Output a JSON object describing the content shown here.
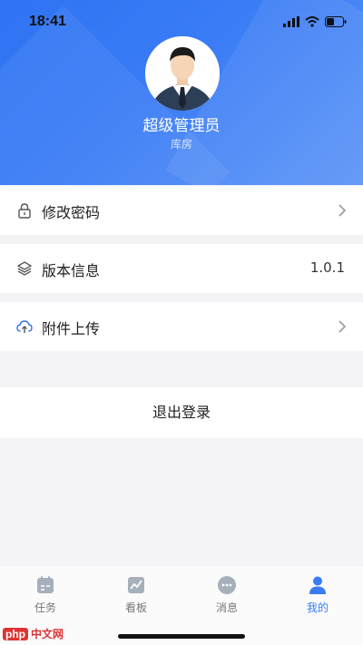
{
  "status_bar": {
    "time": "18:41"
  },
  "profile": {
    "name": "超级管理员",
    "role": "库房"
  },
  "menu": [
    {
      "label": "修改密码",
      "icon": "lock-icon",
      "chevron": true
    },
    {
      "label": "版本信息",
      "icon": "layers-icon",
      "value": "1.0.1"
    },
    {
      "label": "附件上传",
      "icon": "cloud-upload-icon",
      "chevron": true
    }
  ],
  "logout_label": "退出登录",
  "tabs": [
    {
      "label": "任务",
      "icon": "task-icon",
      "active": false
    },
    {
      "label": "看板",
      "icon": "chart-icon",
      "active": false
    },
    {
      "label": "消息",
      "icon": "message-icon",
      "active": false
    },
    {
      "label": "我的",
      "icon": "user-icon",
      "active": true
    }
  ],
  "colors": {
    "primary": "#3a7cf6",
    "inactive": "#9aa3ad"
  },
  "watermark": {
    "badge": "php",
    "text": "中文网"
  }
}
